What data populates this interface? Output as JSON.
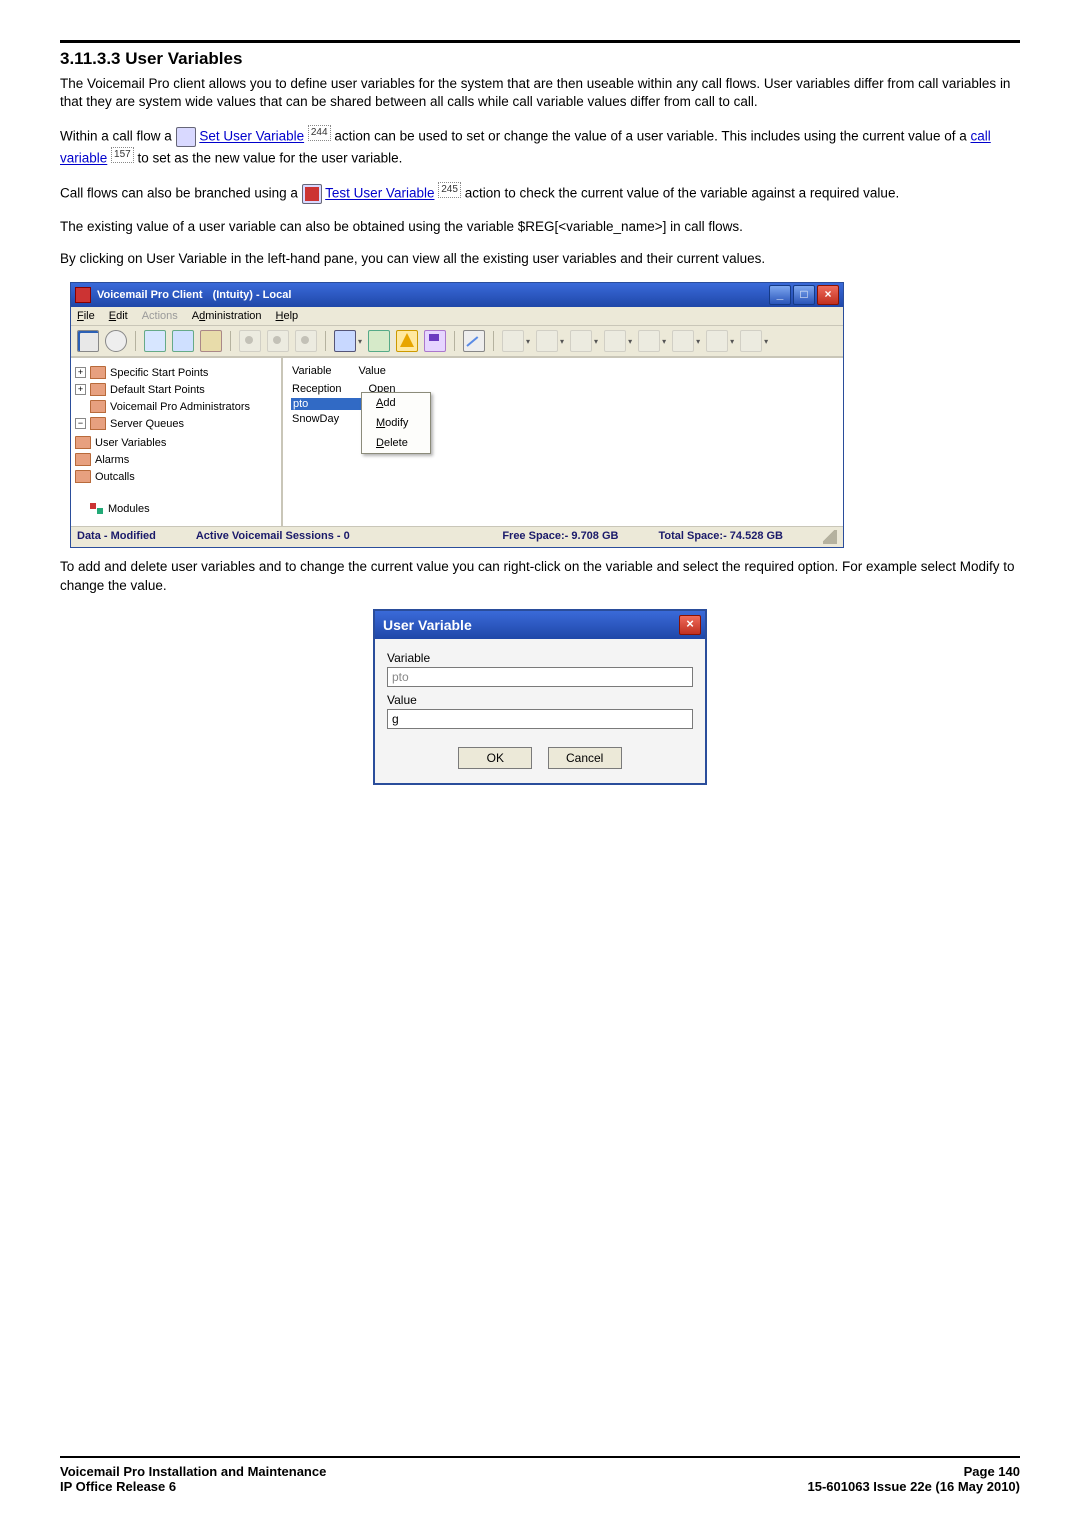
{
  "section": {
    "number": "3.11.3.3",
    "title": "User Variables"
  },
  "paragraphs": {
    "p1": "The Voicemail Pro client allows you to define user variables for the system that are then useable within any call flows. User variables differ from call variables in that they are system wide values that can be shared between all calls while call variable values differ from call to call.",
    "p2a": "Within a call flow a ",
    "p2_link1": "Set User Variable",
    "p2_ref1": "244",
    "p2b": " action can be used to set or change the value of a user variable. This includes using the current value of a ",
    "p2_link2": "call variable",
    "p2_ref2": "157",
    "p2c": " to set as the new value for the user variable.",
    "p3a": "Call flows can also be branched using a ",
    "p3_link1": "Test User Variable",
    "p3_ref1": "245",
    "p3b": " action to check the current value of the variable against a required value.",
    "p4": "The existing value of a user variable can also be obtained using the variable $REG[<variable_name>]  in call flows.",
    "p5": "By clicking on User Variable in the left-hand pane, you can view all the existing user variables and their current values.",
    "p6": "To add and delete user variables and to change the current value you can right-click on the variable and select the required option. For example select Modify to change the value."
  },
  "app": {
    "title": "Voicemail Pro Client",
    "title_sub": "(Intuity) -   Local",
    "menu": {
      "file": "File",
      "edit": "Edit",
      "actions": "Actions",
      "admin": "Administration",
      "help": "Help"
    },
    "tree": {
      "n0": "Specific Start Points",
      "n1": "Default Start Points",
      "n2": "Voicemail Pro Administrators",
      "n3": "Server Queues",
      "n3a": "User Variables",
      "n3b": "Alarms",
      "n3c": "Outcalls",
      "n4": "Modules"
    },
    "table": {
      "h_variable": "Variable",
      "h_value": "Value",
      "r0_var": "Reception",
      "r0_val": "Open",
      "r1_var": "pto",
      "r1_val": "",
      "r2_var": "SnowDay",
      "r2_val": ""
    },
    "ctx": {
      "add": "Add",
      "modify": "Modify",
      "delete": "Delete"
    },
    "status": {
      "data": "Data - Modified",
      "sessions": "Active Voicemail Sessions - 0",
      "free": "Free Space:- 9.708 GB",
      "total": "Total Space:- 74.528 GB"
    }
  },
  "dialog": {
    "title": "User Variable",
    "lbl_variable": "Variable",
    "val_variable": "pto",
    "lbl_value": "Value",
    "val_value": "g",
    "ok": "OK",
    "cancel": "Cancel"
  },
  "footer": {
    "left1": "Voicemail Pro Installation and Maintenance",
    "left2": "IP Office Release 6",
    "right1": "Page 140",
    "right2": "15-601063 Issue 22e (16 May 2010)"
  }
}
